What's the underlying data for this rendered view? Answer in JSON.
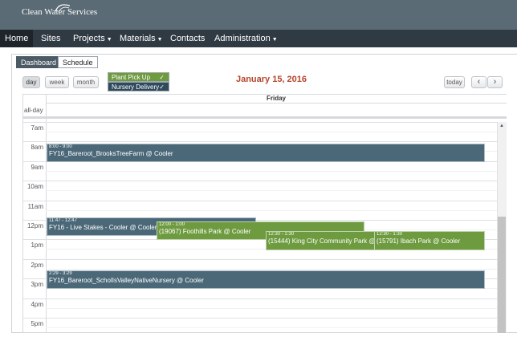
{
  "header": {
    "logo_text": "Clean Water Services",
    "nav": [
      {
        "label": "Home",
        "has_caret": false
      },
      {
        "label": "Sites",
        "has_caret": false
      },
      {
        "label": "Projects",
        "has_caret": true
      },
      {
        "label": "Materials",
        "has_caret": true
      },
      {
        "label": "Contacts",
        "has_caret": false
      },
      {
        "label": "Administration",
        "has_caret": true
      }
    ],
    "active_nav": "Home"
  },
  "tabs": [
    {
      "label": "Dashboard",
      "active": true
    },
    {
      "label": "Schedule",
      "active": false
    }
  ],
  "view_buttons": [
    {
      "label": "day",
      "active": true
    },
    {
      "label": "week",
      "active": false
    },
    {
      "label": "month",
      "active": false
    }
  ],
  "legend": [
    {
      "label": "Plant Pick Up",
      "checked": true,
      "color": "#6e9b3f"
    },
    {
      "label": "Nursery Delivery",
      "checked": true,
      "color": "#2f4a5c"
    }
  ],
  "check_glyph": "✓",
  "calendar": {
    "title": "January 15, 2016",
    "day_header": "Friday",
    "allday_label": "all-day",
    "today_label": "today",
    "prev_icon": "‹",
    "next_icon": "›",
    "hours": [
      "7am",
      "8am",
      "9am",
      "10am",
      "11am",
      "12pm",
      "1pm",
      "2pm",
      "3pm",
      "4pm",
      "5pm"
    ]
  },
  "events": [
    {
      "time": "8:00 - 9:00",
      "title": "FY16_Bareroot_BrooksTreeFarm @ Cooler",
      "type": "Nursery Delivery"
    },
    {
      "time": "11:47 - 12:47",
      "title": "FY16 - Live Stakes - Cooler @ Cooler",
      "type": "Nursery Delivery"
    },
    {
      "time": "12:00 - 1:00",
      "title": "(19067) Foothills Park @ Cooler",
      "type": "Plant Pick Up"
    },
    {
      "time": "12:30 - 1:30",
      "title": "(15444) King City Community Park @ Cooler",
      "type": "Plant Pick Up"
    },
    {
      "time": "12:30 - 1:30",
      "title": "(15791) Ibach Park @ Cooler",
      "type": "Plant Pick Up"
    },
    {
      "time": "2:29 - 3:29",
      "title": "FY16_Bareroot_ScholIsValleyNativeNursery @ Cooler",
      "type": "Nursery Delivery"
    }
  ],
  "colors": {
    "header_bg": "#5b6b76",
    "nav_bg": "#2f3a43",
    "title_color": "#b5452b",
    "nursery_delivery": "#4b6878",
    "plant_pick_up": "#6e9b3f"
  }
}
